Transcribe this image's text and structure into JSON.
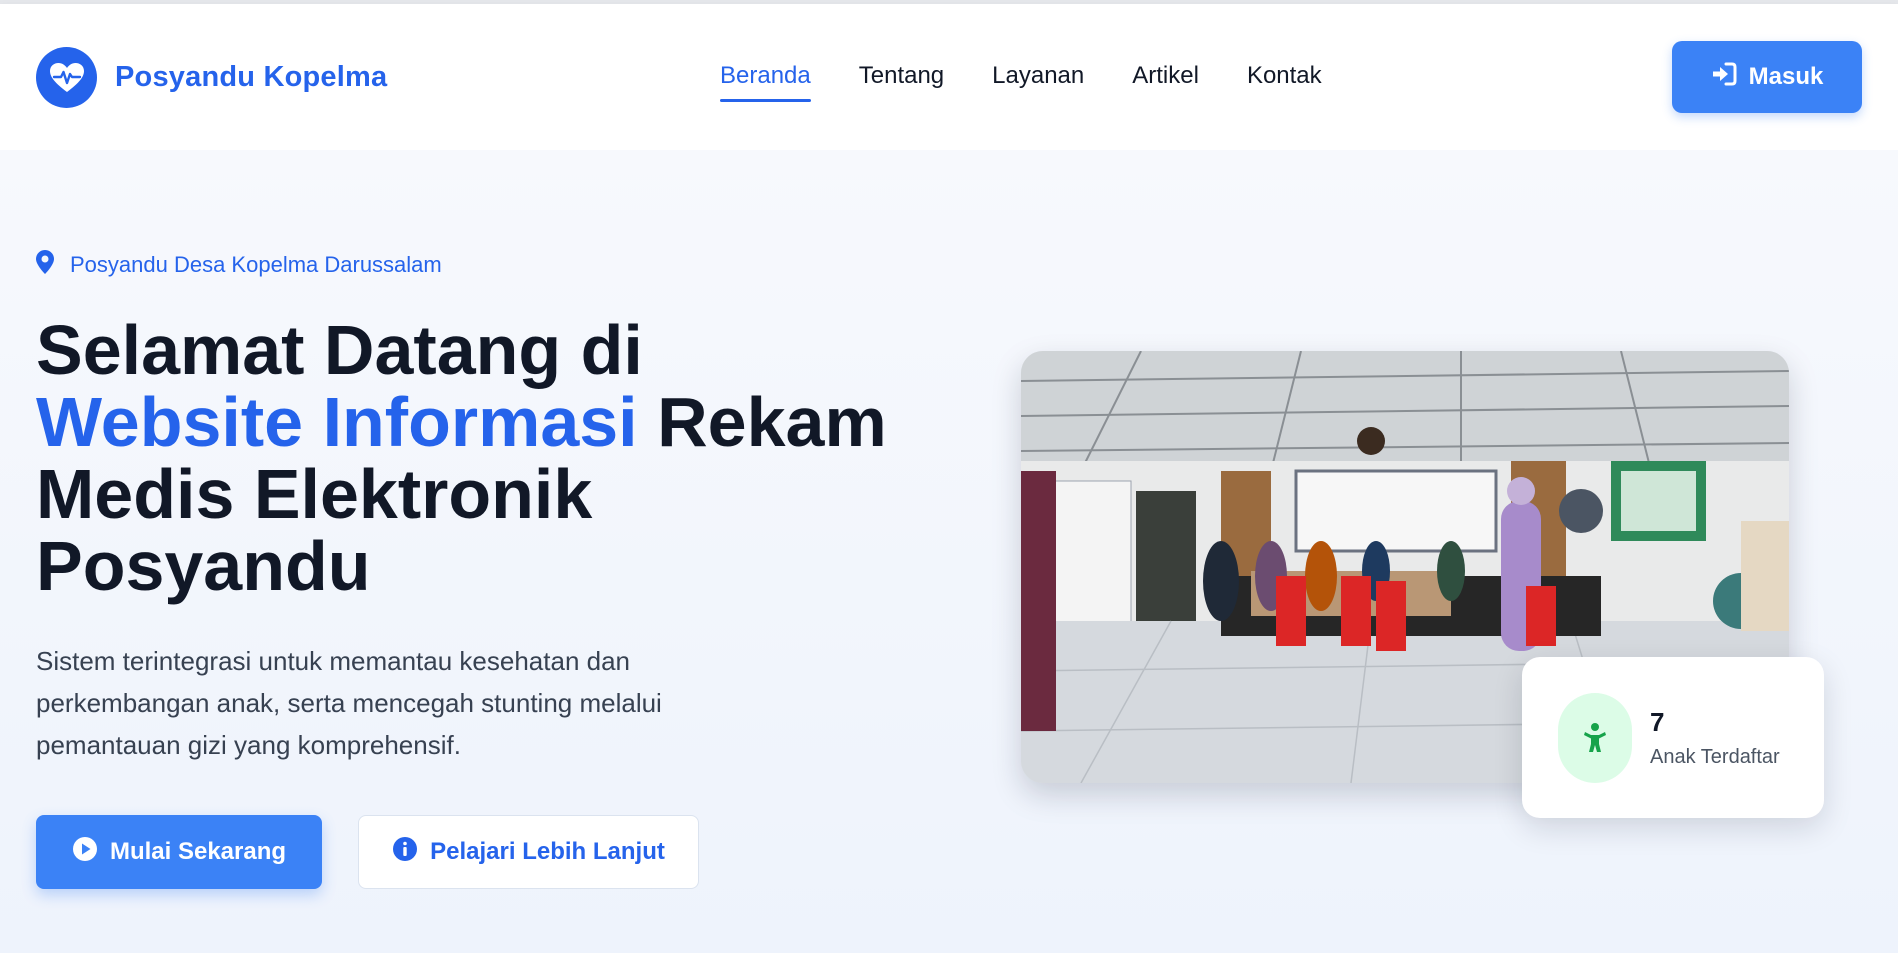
{
  "brand": {
    "name": "Posyandu Kopelma",
    "logo_icon": "heart-pulse-icon",
    "accent_color": "#2563eb"
  },
  "nav": {
    "items": [
      {
        "label": "Beranda",
        "active": true
      },
      {
        "label": "Tentang",
        "active": false
      },
      {
        "label": "Layanan",
        "active": false
      },
      {
        "label": "Artikel",
        "active": false
      },
      {
        "label": "Kontak",
        "active": false
      }
    ]
  },
  "header": {
    "login_label": "Masuk",
    "login_icon": "sign-in-icon",
    "button_color": "#3b82f6"
  },
  "hero": {
    "location_icon": "map-pin-icon",
    "location": "Posyandu Desa Kopelma Darussalam",
    "headline_part1": "Selamat Datang di",
    "headline_accent": "Website Informasi",
    "headline_part2": "Rekam Medis Elektronik Posyandu",
    "description": "Sistem terintegrasi untuk memantau kesehatan dan perkembangan anak, serta mencegah stunting melalui pemantauan gizi yang komprehensif.",
    "primary_button": {
      "label": "Mulai Sekarang",
      "icon": "play-circle-icon"
    },
    "secondary_button": {
      "label": "Pelajari Lebih Lanjut",
      "icon": "info-circle-icon"
    }
  },
  "stat_card": {
    "value": "7",
    "label": "Anak Terdaftar",
    "icon": "child-icon",
    "icon_color": "#16a34a",
    "icon_bg": "#dcfce7"
  }
}
